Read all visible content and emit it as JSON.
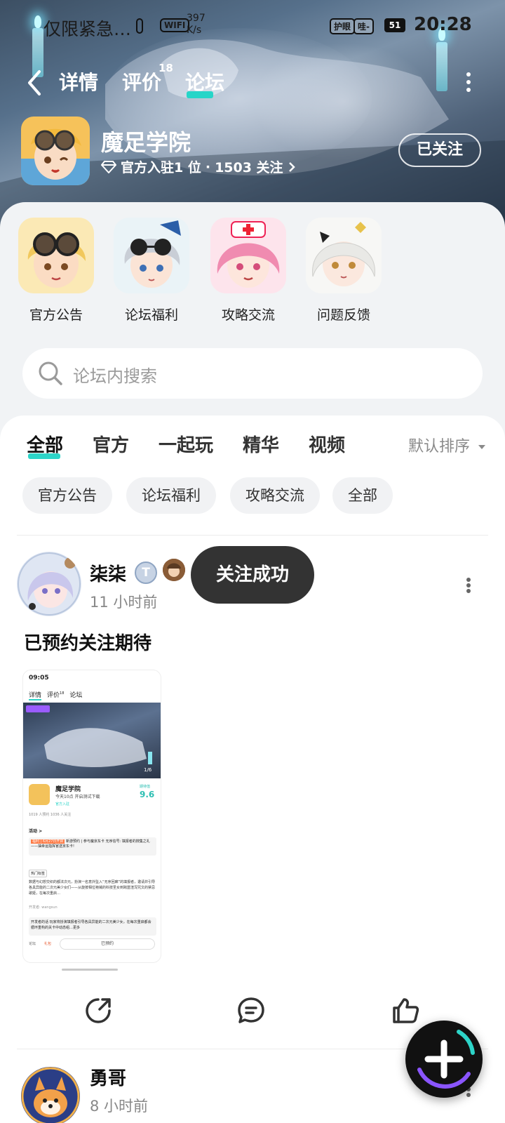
{
  "status_bar": {
    "carrier_text": "仅限紧急…",
    "wifi_label": "WIFI",
    "speed_value": "397",
    "speed_unit": "K/s",
    "eye_tag": "护眼",
    "sound_tag": "哇-",
    "battery": "51",
    "time": "20:28"
  },
  "nav": {
    "tabs": [
      {
        "label": "详情"
      },
      {
        "label": "评价",
        "badge": "18"
      },
      {
        "label": "论坛"
      }
    ],
    "active_tab": "论坛"
  },
  "game": {
    "name": "魔足学院",
    "official_text": "官方入驻1 位",
    "separator": "·",
    "followers": "1503 关注",
    "follow_button": "已关注"
  },
  "categories": [
    {
      "label": "官方公告",
      "icon": "goggles-girl-avatar"
    },
    {
      "label": "论坛福利",
      "icon": "sunglasses-girl-avatar"
    },
    {
      "label": "攻略交流",
      "icon": "nurse-girl-avatar"
    },
    {
      "label": "问题反馈",
      "icon": "white-hair-girl-avatar"
    }
  ],
  "search": {
    "placeholder": "论坛内搜索"
  },
  "feed_tabs": [
    {
      "label": "全部"
    },
    {
      "label": "官方"
    },
    {
      "label": "一起玩"
    },
    {
      "label": "精华"
    },
    {
      "label": "视频"
    }
  ],
  "active_feed_tab": "全部",
  "sort_label": "默认排序",
  "chips": [
    {
      "label": "官方公告"
    },
    {
      "label": "论坛福利"
    },
    {
      "label": "攻略交流"
    },
    {
      "label": "全部"
    }
  ],
  "toast": "关注成功",
  "posts": [
    {
      "user": "柒柒",
      "level_badge": "T",
      "time": "11 小时前",
      "title": "已预约关注期待",
      "screenshot": {
        "time": "09:05",
        "tab1": "详情",
        "tab2": "评价",
        "tab2_badge": "18",
        "tab3": "论坛",
        "page": "1/6",
        "game": "魔足学院",
        "subtitle": "今天10点 开启测试下载",
        "official": "官方入驻",
        "score_label": "期待值",
        "score": "9.6",
        "stats": "1019 人预约   1036 人关注",
        "activity": "活动 >",
        "event_tag": "福利 | 6月27日开启",
        "event_text": "新游预约 | 参与魔京东卡 无序信号: 填报者的搜集之礼——抽幸运指挥官送京东卡!",
        "editor_tag": "热门标签",
        "desc": "数据与幻想交织的都法次元，扮演一名意外坠入“无序回廊”的填报者，邀请并引导各具异能的二次元美少女们——从旋按相位袍械的科技圣女到跨噩渲泻咒文的禁忌歌姬，在每次重启…",
        "dev": "开发者: wangsun",
        "dev_note": "开发者的话  玩家将扮演填报者引导各具异能的二次元美少女，在每次重启都会循环重构的关卡中动态组…更多",
        "bottom_left": "论坛",
        "bottom_mid": "礼包",
        "reserved": "已预约"
      }
    },
    {
      "user": "勇哥",
      "time": "8 小时前"
    }
  ]
}
